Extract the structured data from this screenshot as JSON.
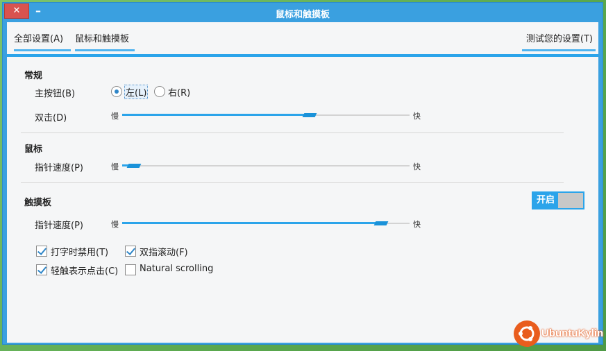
{
  "window": {
    "title": "鼠标和触摸板",
    "close_glyph": "✕",
    "minimize_glyph": "–"
  },
  "nav": {
    "all_settings": "全部设置(A)",
    "current": "鼠标和触摸板",
    "test_settings": "测试您的设置(T)"
  },
  "general": {
    "title": "常规",
    "primary_button_label": "主按钮(B)",
    "left_option": "左(L)",
    "right_option": "右(R)",
    "left_selected": true,
    "double_click_label": "双击(D)",
    "double_click_value": 0.66,
    "slow": "慢",
    "fast": "快"
  },
  "mouse": {
    "title": "鼠标",
    "pointer_speed_label": "指针速度(P)",
    "pointer_speed_value": 0.02,
    "slow": "慢",
    "fast": "快"
  },
  "touchpad": {
    "title": "触摸板",
    "toggle_label": "开启",
    "toggle_on": true,
    "pointer_speed_label": "指针速度(P)",
    "pointer_speed_value": 0.92,
    "slow": "慢",
    "fast": "快",
    "disable_while_typing": "打字时禁用(T)",
    "disable_while_typing_checked": true,
    "two_finger_scroll": "双指滚动(F)",
    "two_finger_scroll_checked": true,
    "tap_to_click": "轻触表示点击(C)",
    "tap_to_click_checked": true,
    "natural_scrolling": "Natural scrolling",
    "natural_scrolling_checked": false
  },
  "branding": {
    "logo_text": "UbuntuKylin",
    "logo_color": "#e95d1e"
  },
  "colors": {
    "accent": "#2ba4ea",
    "close": "#d9534f"
  }
}
